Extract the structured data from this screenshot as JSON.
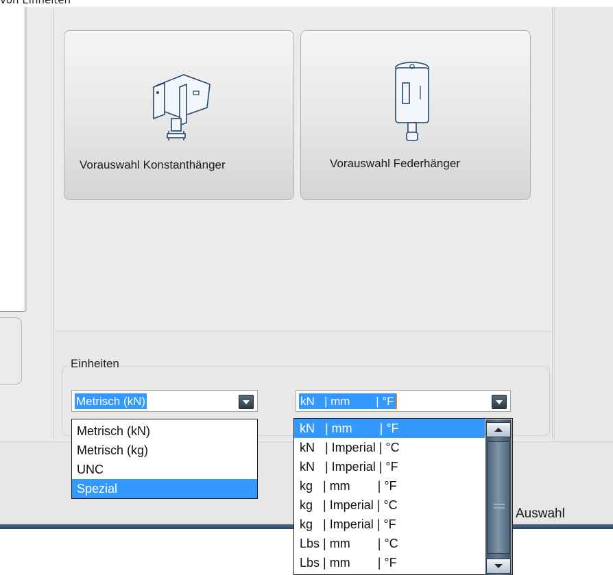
{
  "top_caption": "von Einheiten",
  "tiles": {
    "konstant_label": "Vorauswahl Konstanthänger",
    "feder_label": "Vorauswahl Federhänger"
  },
  "units_group": {
    "legend": "Einheiten",
    "units_combo_value": "Metrisch (kN)",
    "spec_combo_value": "kN   | mm        | °F"
  },
  "units_list": [
    "Metrisch (kN)",
    "Metrisch (kg)",
    "UNC",
    "Spezial"
  ],
  "spec_list": [
    "kN   | mm        | °F",
    "kN   | Imperial | °C",
    "kN   | Imperial | °F",
    "kg   | mm        | °F",
    "kg   | Imperial | °C",
    "kg   | Imperial | °F",
    "Lbs | mm        | °C",
    "Lbs | mm        | °F"
  ],
  "status_bar": {
    "text": "Auswahl"
  },
  "colors": {
    "selection": "#3399ff",
    "scrollbar": "#4e6479"
  }
}
